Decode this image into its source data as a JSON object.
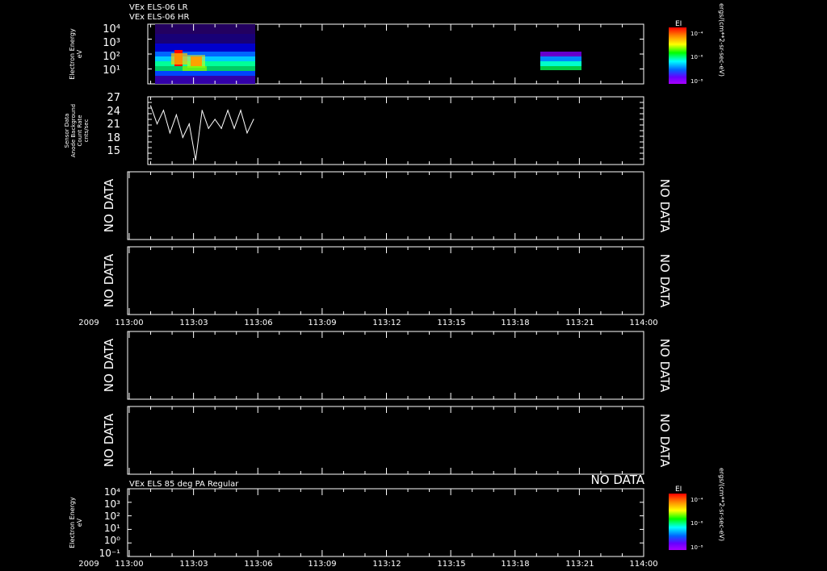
{
  "header": {
    "line1": "VEx ELS-06 LR",
    "line2": "VEx ELS-06 HR"
  },
  "bottom_title": "VEx ELS 85 deg PA Regular",
  "no_data": "NO DATA",
  "colorbar": {
    "label": "EI",
    "unit": "ergs/(cm**2-sr-sec-eV)",
    "ticks": [
      "10⁻⁴",
      "10⁻⁶",
      "10⁻⁸"
    ],
    "stops": [
      "#ff0000",
      "#ff8800",
      "#ffff00",
      "#00ff00",
      "#00ffff",
      "#0066ff",
      "#6600ff",
      "#aa00ff"
    ]
  },
  "panel1": {
    "ylabel_1": "Electron Energy",
    "ylabel_2": "eV",
    "ticks": [
      "10⁴",
      "10³",
      "10²",
      "10¹"
    ]
  },
  "panel2": {
    "ylabel_1": "Sensor Data",
    "ylabel_2": "Anode Background",
    "ylabel_3": "Count Rate",
    "ylabel_4": "cnts/sec",
    "ticks": [
      "27",
      "24",
      "21",
      "18",
      "15"
    ]
  },
  "panel7": {
    "ylabel_1": "Electron Energy",
    "ylabel_2": "eV",
    "ticks": [
      "10⁴",
      "10³",
      "10²",
      "10¹",
      "10⁰",
      "10⁻¹"
    ]
  },
  "xaxis": {
    "year": "2009",
    "ticks": [
      "113:00",
      "113:03",
      "113:06",
      "113:09",
      "113:12",
      "113:15",
      "113:18",
      "113:21",
      "114:00"
    ]
  },
  "chart_data": [
    {
      "type": "heatmap",
      "title": "VEx ELS-06 LR / VEx ELS-06 HR",
      "ylabel": "Electron Energy eV",
      "y_scale": "log",
      "x_range": [
        "113:00",
        "114:00"
      ],
      "coverage": [
        {
          "from": "113:01",
          "to": "113:06"
        },
        {
          "from": "113:18",
          "to": "113:20"
        }
      ],
      "colorbar_label": "EI"
    },
    {
      "type": "line",
      "ylabel": "Sensor Data Anode Background Count Rate cnts/sec",
      "ylim": [
        12,
        27
      ],
      "x": [
        "113:01.0",
        "113:01.3",
        "113:01.6",
        "113:01.9",
        "113:02.2",
        "113:02.5",
        "113:02.8",
        "113:03.1",
        "113:03.4",
        "113:03.7",
        "113:04.0",
        "113:04.3",
        "113:04.6",
        "113:04.9",
        "113:05.2",
        "113:05.5",
        "113:05.8"
      ],
      "values": [
        25,
        21,
        24,
        19,
        23,
        18,
        21,
        13,
        24,
        20,
        22,
        20,
        24,
        20,
        24,
        19,
        22
      ]
    },
    {
      "type": "heatmap",
      "title": "VEx ELS 85 deg PA Regular",
      "ylabel": "Electron Energy eV",
      "y_scale": "log",
      "coverage": []
    }
  ]
}
